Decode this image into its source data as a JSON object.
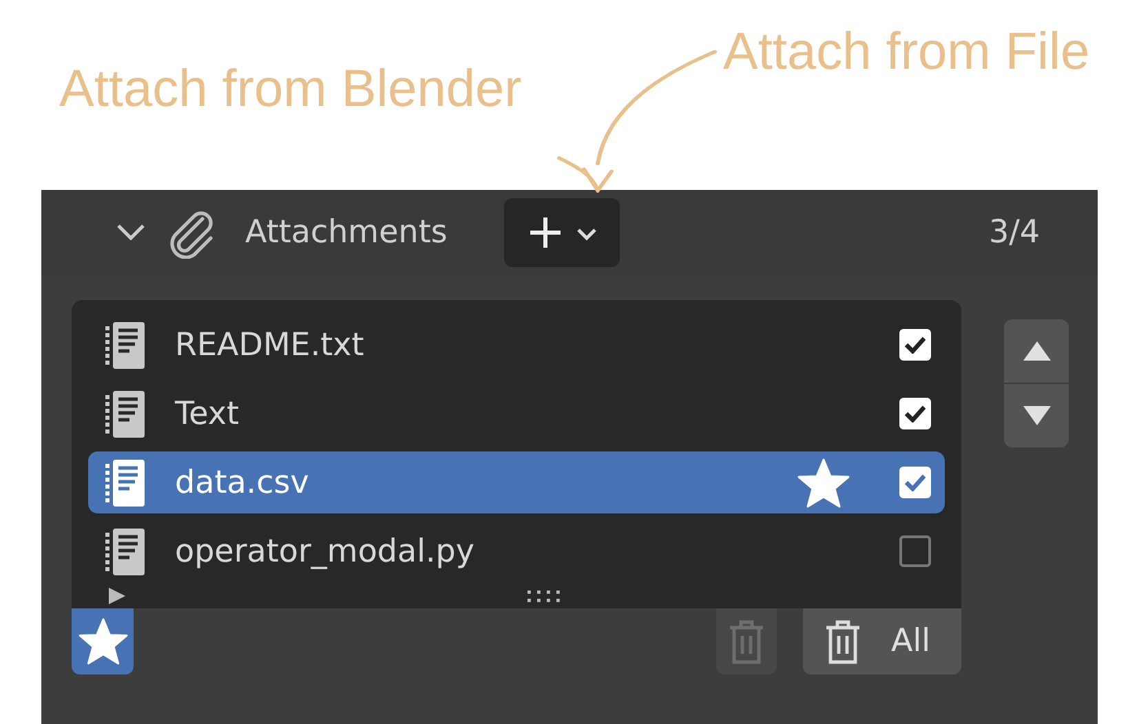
{
  "annotations": [
    {
      "text": "Attach from Blender"
    },
    {
      "text": "Attach from File"
    }
  ],
  "panel": {
    "title": "Attachments",
    "expanded": true,
    "count": "3/4"
  },
  "items": [
    {
      "name": "README.txt",
      "selected": false,
      "checked": true,
      "starred": false
    },
    {
      "name": "Text",
      "selected": false,
      "checked": true,
      "starred": false
    },
    {
      "name": "data.csv",
      "selected": true,
      "checked": true,
      "starred": true
    },
    {
      "name": "operator_modal.py",
      "selected": false,
      "checked": false,
      "starred": false
    }
  ],
  "list_options_expanded": false,
  "footer": {
    "favorite_on": true,
    "remove_disabled": true,
    "remove_all_label": "All"
  }
}
